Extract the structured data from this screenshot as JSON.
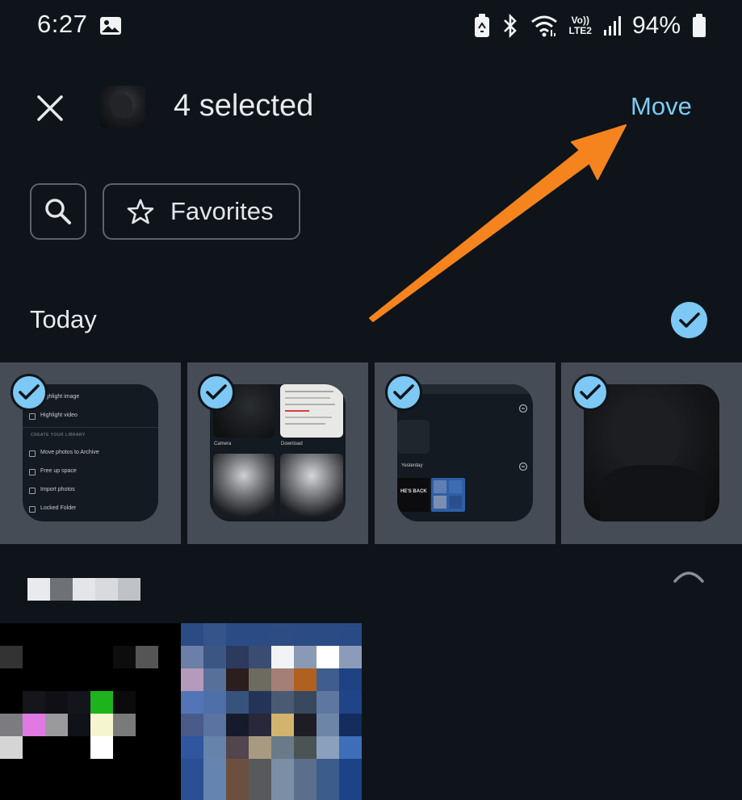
{
  "status_bar": {
    "time": "6:27",
    "network_top": "Vo))",
    "network_bottom": "LTE2",
    "battery": "94%"
  },
  "app_bar": {
    "selected_label": "4 selected",
    "move_label": "Move"
  },
  "chips": {
    "favorites_label": "Favorites"
  },
  "section": {
    "title": "Today"
  },
  "thumb1": {
    "items": [
      "Highlight video",
      "Move photos to Archive",
      "Free up space",
      "Import photos",
      "Locked Folder"
    ],
    "header": "CREATE YOUR LIBRARY"
  },
  "thumb2": {
    "labels": [
      "Camera",
      "Download"
    ]
  },
  "thumb3": {
    "label": "Yesterday",
    "card_text": "HE'S BACK"
  },
  "colors": {
    "background": "#0e1419",
    "accent": "#7dc8f4",
    "annotation_arrow": "#f5841f"
  }
}
